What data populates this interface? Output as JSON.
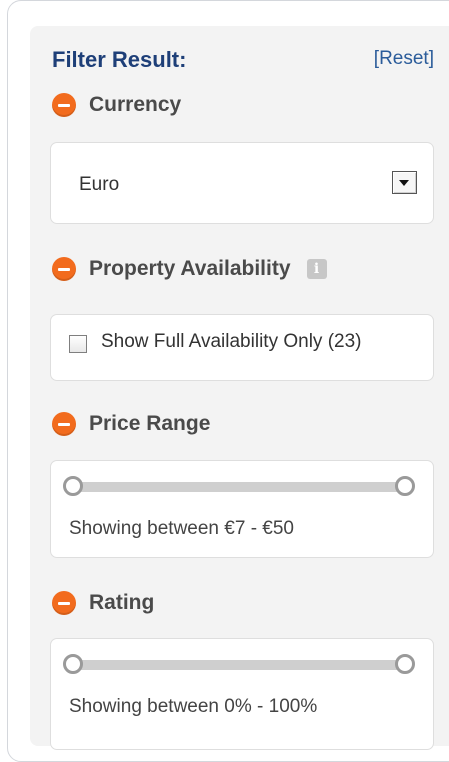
{
  "filter": {
    "title": "Filter Result:",
    "reset_label": "[Reset]"
  },
  "currency": {
    "heading": "Currency",
    "selected": "Euro"
  },
  "availability": {
    "heading": "Property Availability",
    "info_label": "i",
    "checkbox_label": "Show Full Availability Only (23)",
    "checked": false
  },
  "price_range": {
    "heading": "Price Range",
    "summary": "Showing between €7 - €50",
    "min_fraction": 0.0,
    "max_fraction": 1.0
  },
  "rating": {
    "heading": "Rating",
    "summary": "Showing between 0% - 100%",
    "min_fraction": 0.0,
    "max_fraction": 1.0
  },
  "colors": {
    "accent": "#f26b1d",
    "title": "#1e3f78",
    "link": "#2b5c9a"
  },
  "icons": {
    "section_toggle": "minus-circle-icon",
    "info": "info-icon",
    "dropdown": "chevron-down-icon"
  }
}
